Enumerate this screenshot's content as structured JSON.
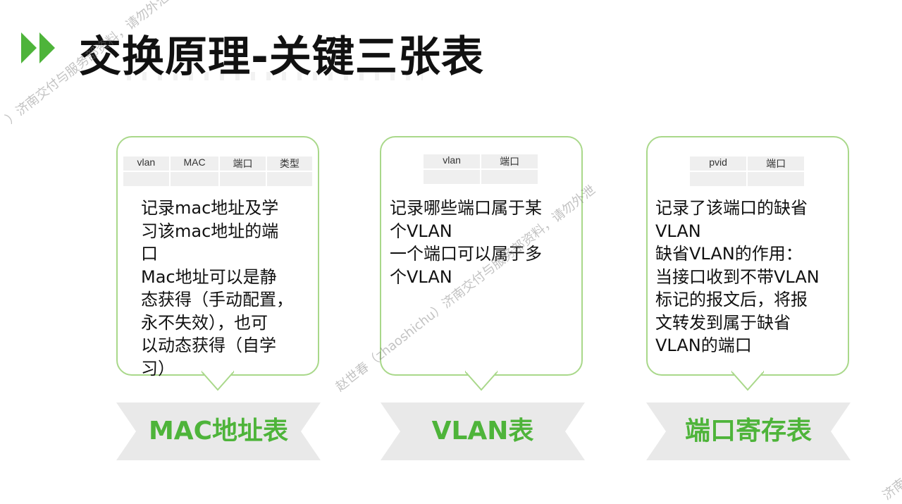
{
  "title": "交换原理-关键三张表",
  "cards": [
    {
      "table_headers": [
        "vlan",
        "MAC",
        "端口",
        "类型"
      ],
      "text_lines": [
        "记录mac地址及学",
        "习该mac地址的端",
        "口",
        "Mac地址可以是静",
        "态获得（手动配置，",
        "永不失效），也可",
        "以动态获得（自学",
        "习）"
      ],
      "banner": "MAC地址表"
    },
    {
      "table_headers": [
        "vlan",
        "端口"
      ],
      "text_lines": [
        "记录哪些端口属于某",
        "个VLAN",
        "一个端口可以属于多",
        "个VLAN"
      ],
      "banner": "VLAN表"
    },
    {
      "table_headers": [
        "pvid",
        "端口"
      ],
      "text_lines": [
        "记录了该端口的缺省",
        "VLAN",
        "缺省VLAN的作用：",
        "当接口收到不带VLAN",
        "标记的报文后，将报",
        "文转发到属于缺省",
        "VLAN的端口"
      ],
      "banner": "端口寄存表"
    }
  ],
  "watermarks": [
    "）济南交付与服务部资料，请勿外泄",
    "赵世春（zhaoshichu）济南交付与服务部资料，请勿外泄",
    "济南"
  ],
  "colors": {
    "accent": "#4eb43a",
    "card_border": "#a9d88a",
    "banner_bg": "#e9e9e9"
  }
}
